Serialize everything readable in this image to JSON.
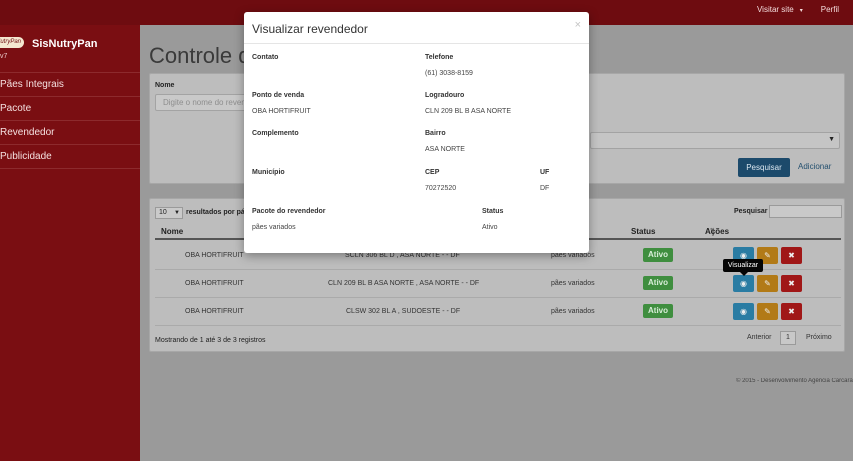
{
  "topbar": {
    "visit_site": "Visitar site",
    "profile": "Perfil",
    "caret": "▾"
  },
  "sidebar": {
    "logo_text": "NutryPan",
    "brand": "SisNutryPan",
    "brand_sub": "v7",
    "items": [
      {
        "label": "Pães Integrais"
      },
      {
        "label": "Pacote"
      },
      {
        "label": "Revendedor"
      },
      {
        "label": "Publicidade"
      }
    ]
  },
  "main": {
    "title": "Controle de Revendedores",
    "filter": {
      "name_label": "Nome",
      "name_placeholder": "Digite o nome do revendedor",
      "select_arrow": "▼",
      "search_button": "Pesquisar",
      "add_button": "Adicionar"
    },
    "table": {
      "page_length": "10",
      "page_length_suffix": "resultados por página",
      "search_label": "Pesquisar",
      "columns": [
        "Nome",
        "Status",
        "Ações"
      ],
      "sort_icon": "⇅",
      "rows": [
        {
          "name": "OBA HORTIFRUIT",
          "address": "SCLN 306 BL D , ASA NORTE - - DF",
          "package": "pães variados",
          "status": "Ativo"
        },
        {
          "name": "OBA HORTIFRUIT",
          "address": "CLN 209 BL B ASA NORTE , ASA NORTE - - DF",
          "package": "pães variados",
          "status": "Ativo"
        },
        {
          "name": "OBA HORTIFRUIT",
          "address": "CLSW 302 BL A , SUDOESTE - - DF",
          "package": "pães variados",
          "status": "Ativo"
        }
      ],
      "icons": {
        "view": "◉",
        "edit": "✎",
        "delete": "✖"
      },
      "info": "Mostrando de 1 até 3 de 3 registros",
      "prev": "Anterior",
      "page": "1",
      "next": "Próximo",
      "tooltip": "Visualizar"
    },
    "footer": "© 2015 - Desenvolvimento Agência Carcará"
  },
  "modal": {
    "title": "Visualizar revendedor",
    "close": "×",
    "fields": {
      "contato": {
        "label": "Contato",
        "value": ""
      },
      "telefone": {
        "label": "Telefone",
        "value": "(61) 3038-8159"
      },
      "ponto": {
        "label": "Ponto de venda",
        "value": "OBA HORTIFRUIT"
      },
      "logradouro": {
        "label": "Logradouro",
        "value": "CLN 209 BL B ASA NORTE"
      },
      "complemento": {
        "label": "Complemento",
        "value": ""
      },
      "bairro": {
        "label": "Bairro",
        "value": "ASA NORTE"
      },
      "municipio": {
        "label": "Município",
        "value": ""
      },
      "cep": {
        "label": "CEP",
        "value": "70272520"
      },
      "uf": {
        "label": "UF",
        "value": "DF"
      },
      "pacote": {
        "label": "Pacote do revendedor",
        "value": "pães variados"
      },
      "status": {
        "label": "Status",
        "value": "Ativo"
      }
    }
  },
  "colors": {
    "sidebar": "#7a0e12",
    "topbar": "#6e0c10",
    "primary_button": "#1c4a6b",
    "active_badge": "#3f8e3f",
    "view_button": "#2a7ca3",
    "edit_button": "#b27a17",
    "delete_button": "#a01717"
  }
}
